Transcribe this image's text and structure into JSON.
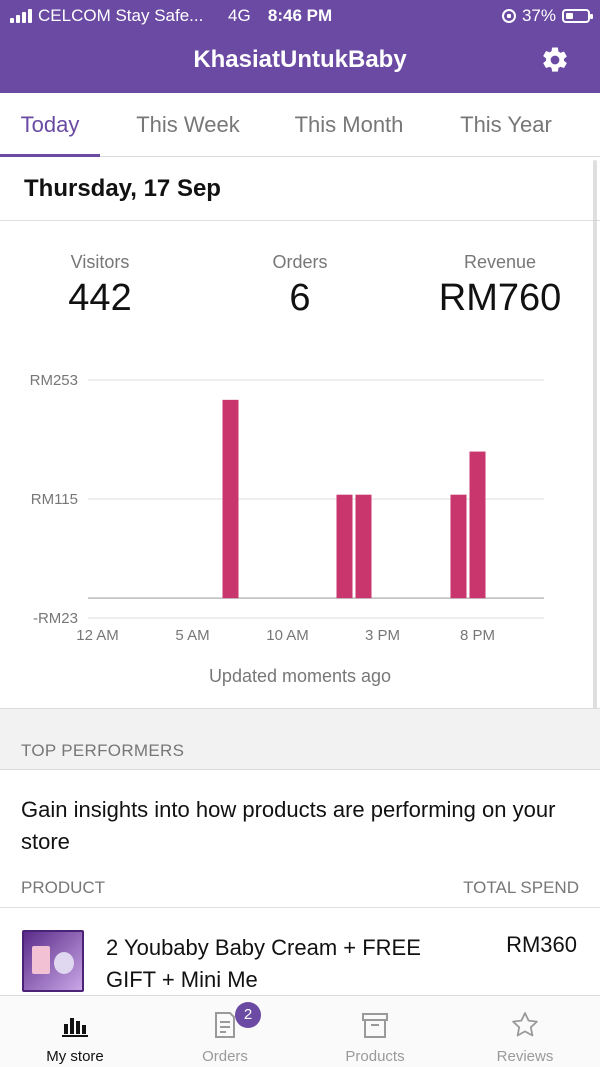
{
  "status_bar": {
    "carrier": "CELCOM Stay Safe...",
    "network": "4G",
    "time": "8:46 PM",
    "battery": "37%",
    "battery_level": 0.37
  },
  "header": {
    "title": "KhasiatUntukBaby",
    "settings_icon": "gear-icon"
  },
  "tabs": [
    {
      "label": "Today",
      "active": true
    },
    {
      "label": "This Week",
      "active": false
    },
    {
      "label": "This Month",
      "active": false
    },
    {
      "label": "This Year",
      "active": false
    }
  ],
  "date": "Thursday, 17 Sep",
  "stats": {
    "visitors": {
      "label": "Visitors",
      "value": "442"
    },
    "orders": {
      "label": "Orders",
      "value": "6"
    },
    "revenue": {
      "label": "Revenue",
      "value": "RM760"
    }
  },
  "chart_data": {
    "type": "bar",
    "title": "",
    "xlabel": "",
    "ylabel": "",
    "ylim": [
      -23,
      253
    ],
    "y_tick_labels": [
      "RM253",
      "RM115",
      "-RM23"
    ],
    "y_ticks": [
      253,
      115,
      -23
    ],
    "x_tick_labels": [
      "12 AM",
      "5 AM",
      "10 AM",
      "3 PM",
      "8 PM"
    ],
    "x_ticks": [
      0,
      5,
      10,
      15,
      20
    ],
    "x_range": [
      -0.5,
      23.5
    ],
    "bars": [
      {
        "hour": 7,
        "value": 230
      },
      {
        "hour": 13,
        "value": 120
      },
      {
        "hour": 14,
        "value": 120
      },
      {
        "hour": 19,
        "value": 120
      },
      {
        "hour": 20,
        "value": 170
      }
    ],
    "bar_color": "#c8366d",
    "grid": true
  },
  "updated_text": "Updated moments ago",
  "top_performers": {
    "section_title": "TOP PERFORMERS",
    "insight": "Gain insights into how products are performing on your store",
    "col_product": "PRODUCT",
    "col_spend": "TOTAL SPEND",
    "items": [
      {
        "name": "2 Youbaby Baby Cream + FREE GIFT + Mini Me",
        "spend": "RM360"
      }
    ]
  },
  "bottom_nav": [
    {
      "label": "My store",
      "icon": "bar-chart-icon",
      "active": true
    },
    {
      "label": "Orders",
      "icon": "orders-icon",
      "badge": "2",
      "active": false
    },
    {
      "label": "Products",
      "icon": "archive-box-icon",
      "active": false
    },
    {
      "label": "Reviews",
      "icon": "star-icon",
      "active": false
    }
  ],
  "colors": {
    "brand": "#6a4aa3",
    "bar": "#c8366d"
  }
}
